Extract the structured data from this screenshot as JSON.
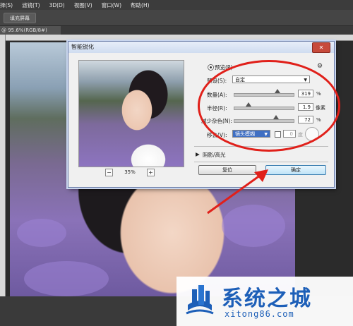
{
  "menubar": {
    "items": [
      "择(S)",
      "滤镜(T)",
      "3D(D)",
      "视图(V)",
      "窗口(W)",
      "帮助(H)"
    ]
  },
  "options": {
    "fill_button": "填充屏幕"
  },
  "document": {
    "tab_label": "@ 95.6%(RGB/8#)"
  },
  "dialog": {
    "title": "智能锐化",
    "close_glyph": "✕",
    "preview_label": "预览(P)",
    "preview_checked": true,
    "preset_label": "预设(S):",
    "preset_value": "自定",
    "gear_glyph": "⚙",
    "amount_label": "数量(A):",
    "amount_value": "319",
    "amount_unit": "%",
    "amount_slider": 0.74,
    "radius_label": "半径(R):",
    "radius_value": "1.9",
    "radius_unit": "像素",
    "radius_slider": 0.25,
    "noise_label": "减少杂色(N):",
    "noise_value": "72",
    "noise_unit": "%",
    "noise_slider": 0.72,
    "remove_label": "移去(V):",
    "remove_value": "镜头模糊",
    "angle_value": "0",
    "angle_unit": "度",
    "shadows_label": "阴影/高光",
    "zoom_minus": "−",
    "zoom_value": "35%",
    "zoom_plus": "+",
    "reset_button": "复位",
    "ok_button": "确定"
  },
  "watermark": {
    "title": "系统之城",
    "url": "xitong86.com"
  },
  "colors": {
    "annotation_red": "#e0201a",
    "watermark_blue": "#1d5fb8"
  }
}
